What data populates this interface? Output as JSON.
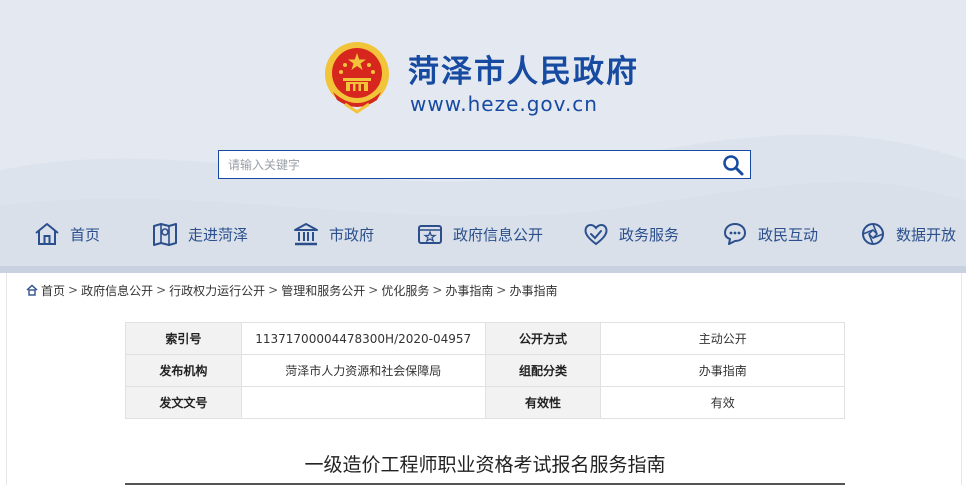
{
  "site": {
    "title": "菏泽市人民政府",
    "url": "www.heze.gov.cn"
  },
  "search": {
    "placeholder": "请输入关键字"
  },
  "nav": {
    "items": [
      {
        "label": "首页",
        "icon": "home-icon"
      },
      {
        "label": "走进菏泽",
        "icon": "map-icon"
      },
      {
        "label": "市政府",
        "icon": "government-building-icon"
      },
      {
        "label": "政府信息公开",
        "icon": "info-card-icon"
      },
      {
        "label": "政务服务",
        "icon": "handshake-heart-icon"
      },
      {
        "label": "政民互动",
        "icon": "chat-bubble-icon"
      },
      {
        "label": "数据开放",
        "icon": "data-aperture-icon"
      }
    ]
  },
  "breadcrumb": {
    "items": [
      "首页",
      "政府信息公开",
      "行政权力运行公开",
      "管理和服务公开",
      "优化服务",
      "办事指南",
      "办事指南"
    ],
    "separator": ">"
  },
  "info_table": {
    "index_label": "索引号",
    "index_value": "11371700004478300H/2020-04957",
    "public_method_label": "公开方式",
    "public_method_value": "主动公开",
    "publisher_label": "发布机构",
    "publisher_value": "菏泽市人力资源和社会保障局",
    "category_label": "组配分类",
    "category_value": "办事指南",
    "doc_number_label": "发文文号",
    "doc_number_value": "",
    "validity_label": "有效性",
    "validity_value": "有效"
  },
  "document": {
    "title": "一级造价工程师职业资格考试报名服务指南"
  },
  "colors": {
    "brand_blue": "#174aa1",
    "nav_blue": "#2b4f8c",
    "header_bg": "#e4e9f1",
    "emblem_red": "#d7261e",
    "emblem_gold": "#f2c43a"
  }
}
